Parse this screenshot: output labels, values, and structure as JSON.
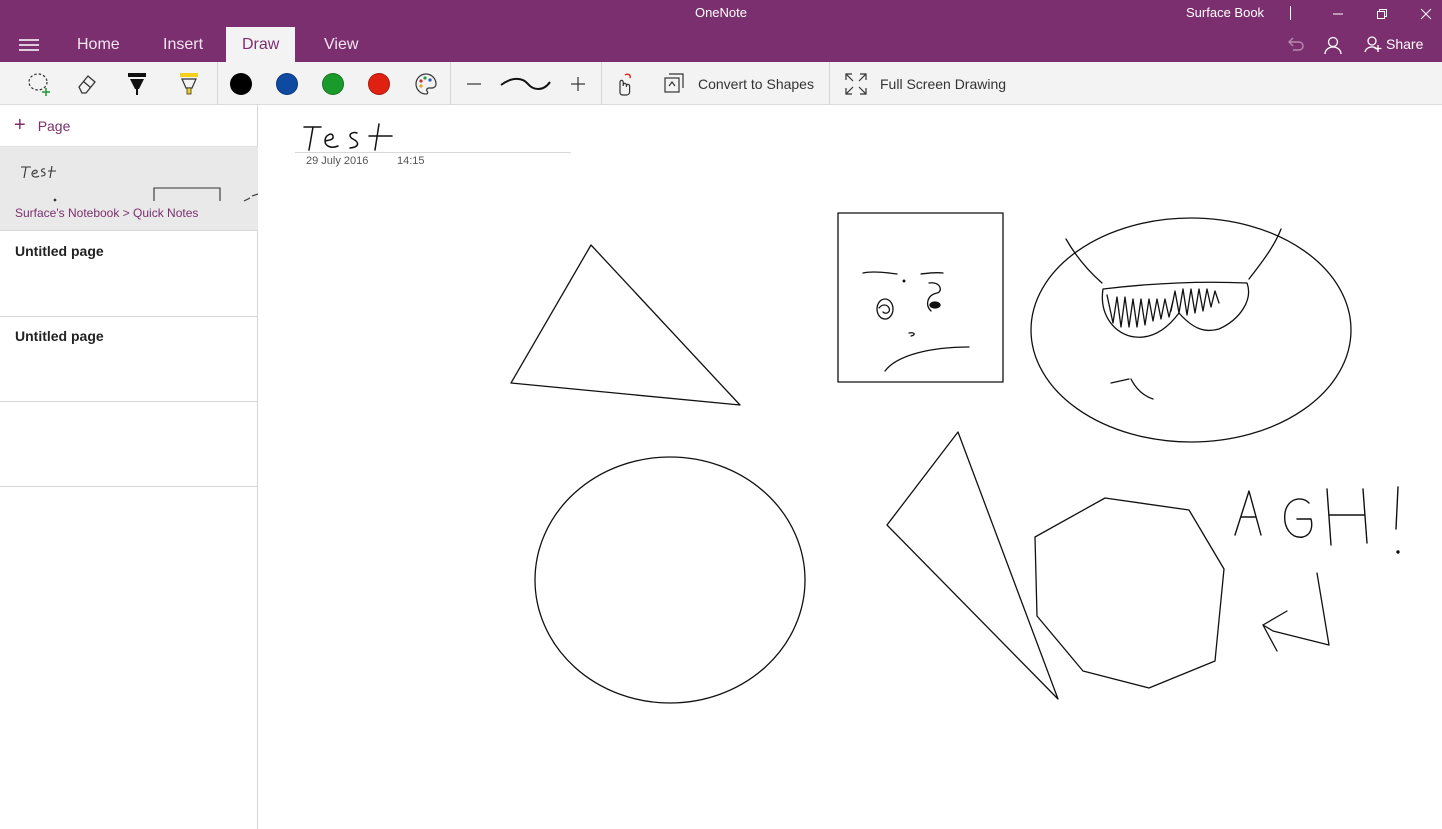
{
  "window": {
    "title": "OneNote",
    "device": "Surface Book"
  },
  "tabs": [
    {
      "label": "Home"
    },
    {
      "label": "Insert"
    },
    {
      "label": "Draw"
    },
    {
      "label": "View"
    }
  ],
  "header_right": {
    "share_label": "Share"
  },
  "toolbar": {
    "pen_colors": [
      "#000000",
      "#0e4aa0",
      "#1a9a2a",
      "#e02010"
    ],
    "convert_label": "Convert to Shapes",
    "fullscreen_label": "Full Screen Drawing"
  },
  "sidebar": {
    "add_page_label": "Page",
    "current_page": {
      "breadcrumb": "Surface's Notebook > Quick Notes"
    },
    "pages": [
      {
        "title": "Untitled page"
      },
      {
        "title": "Untitled page"
      }
    ]
  },
  "note": {
    "date": "29 July 2016",
    "time": "14:15"
  },
  "colors": {
    "brand": "#7b2f6f",
    "toolbar_bg": "#f3f3f3",
    "selected_page_bg": "#e9e9e9"
  }
}
